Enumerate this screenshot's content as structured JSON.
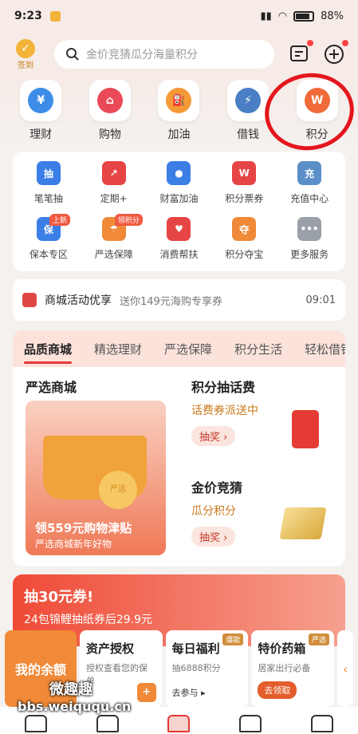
{
  "status": {
    "time": "9:23",
    "battery": "88%"
  },
  "header": {
    "signin_label": "签到",
    "search_placeholder": "金价竞猜瓜分海量积分"
  },
  "quick": [
    {
      "label": "理财",
      "icon": "wealth-icon",
      "color": "#3d8de8",
      "glyph": "¥"
    },
    {
      "label": "购物",
      "icon": "shopping-bag-icon",
      "color": "#ea4a57",
      "glyph": "⌂"
    },
    {
      "label": "加油",
      "icon": "fuel-icon",
      "color": "#f59a35",
      "glyph": "⛽"
    },
    {
      "label": "借钱",
      "icon": "lightning-shield-icon",
      "color": "#4a7fc6",
      "glyph": "⚡"
    },
    {
      "label": "积分",
      "icon": "points-icon",
      "color": "#f06a3a",
      "glyph": "W"
    }
  ],
  "services": [
    {
      "label": "笔笔抽",
      "icon": "lottery-bag-icon",
      "color": "#3b7ee6",
      "glyph": "抽",
      "tag": ""
    },
    {
      "label": "定期+",
      "icon": "chart-up-icon",
      "color": "#e64545",
      "glyph": "↗",
      "tag": ""
    },
    {
      "label": "财富加油",
      "icon": "wealth-fuel-icon",
      "color": "#3b7ee6",
      "glyph": "●",
      "tag": ""
    },
    {
      "label": "积分票券",
      "icon": "ticket-icon",
      "color": "#e64545",
      "glyph": "W",
      "tag": ""
    },
    {
      "label": "充值中心",
      "icon": "recharge-icon",
      "color": "#5b8fc7",
      "glyph": "充",
      "tag": ""
    },
    {
      "label": "保本专区",
      "icon": "shield-bao-icon",
      "color": "#3b7ee6",
      "glyph": "保",
      "tag": "上新"
    },
    {
      "label": "严选保障",
      "icon": "umbrella-icon",
      "color": "#f08a38",
      "glyph": "☂",
      "tag": "领积分"
    },
    {
      "label": "消费帮扶",
      "icon": "helping-hand-icon",
      "color": "#e64545",
      "glyph": "♥",
      "tag": ""
    },
    {
      "label": "积分夺宝",
      "icon": "treasure-icon",
      "color": "#f08a38",
      "glyph": "夺",
      "tag": ""
    },
    {
      "label": "更多服务",
      "icon": "more-icon",
      "color": "#9aa0a8",
      "glyph": "•••",
      "tag": ""
    }
  ],
  "notice": {
    "title": "商城活动优享",
    "text": "送你149元海购专享券",
    "time": "09:01"
  },
  "mall": {
    "tabs": [
      "品质商城",
      "精选理财",
      "严选保障",
      "积分生活",
      "轻松借钱"
    ],
    "left_title": "严选商城",
    "left_line1": "领559元购物津贴",
    "left_line2": "严选商城新年好物",
    "coin_text": "严选",
    "r1": {
      "title": "积分抽话费",
      "sub": "话费券派送中",
      "btn": "抽奖 ›"
    },
    "r2": {
      "title": "金价竞猜",
      "sub": "瓜分积分",
      "btn": "抽奖 ›"
    }
  },
  "coupon": {
    "title": "抽30元券!",
    "sub": "24包锦鲤抽纸券后29.9元"
  },
  "widgets": {
    "balance": "我的余额",
    "w1": {
      "title": "资产授权",
      "sub": "授权查看您的保单"
    },
    "w2": {
      "title": "每日福利",
      "sub": "抽6888积分",
      "act": "去参与 ▸",
      "ribbon": "爆款"
    },
    "w3": {
      "title": "特价药箱",
      "sub": "居家出行必备",
      "btn": "去领取",
      "ribbon": "严选"
    }
  },
  "watermark": {
    "line1": "微趣趣",
    "line2": "bbs.weiququ.cn"
  }
}
